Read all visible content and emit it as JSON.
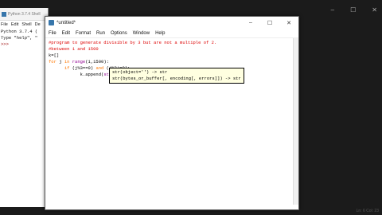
{
  "shell": {
    "title": "Python 3.7.4 Shell",
    "menu": [
      "File",
      "Edit",
      "Shell",
      "De"
    ],
    "lines": [
      "Python 3.7.4 (",
      "Type \"help\", \""
    ],
    "prompt": ">>>"
  },
  "editor": {
    "title": "*untitled*",
    "menu": [
      "File",
      "Edit",
      "Format",
      "Run",
      "Options",
      "Window",
      "Help"
    ],
    "controls": {
      "minimize": "–",
      "maximize": "☐",
      "close": "✕"
    },
    "code": {
      "line1": "#program to generate divisible by 3 but are not a multiple of 2.",
      "line2": "#between 1 and 1500",
      "line3": "k=[]",
      "line4_kw": "for",
      "line4_mid": " j ",
      "line4_in": "in",
      "line4_bi": " range",
      "line4_rest": "(1,1500):",
      "line5_if": "if",
      "line5_a": " (j%3==0) ",
      "line5_and": "and",
      "line5_b": " (j%2!=0):",
      "line6_a": "k.append(",
      "line6_bi": "str",
      "line6_b": "("
    },
    "calltip": {
      "line1": "str(object='') -> str",
      "line2": "str(bytes_or_buffer[, encoding[, errors]]) -> str"
    }
  },
  "status": "Ln: 6 Col: 23"
}
